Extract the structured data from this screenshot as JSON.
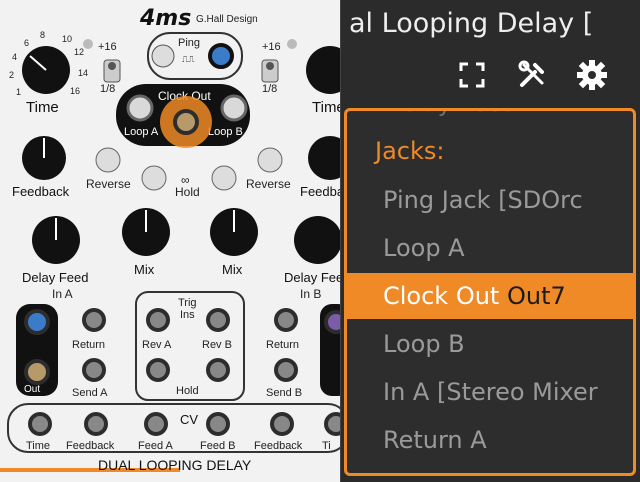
{
  "module": {
    "brand": "4ms",
    "maker": "G.Hall Design",
    "name": "DUAL LOOPING DELAY",
    "ping_label": "Ping",
    "ping_sub": "⎍⎍",
    "clock_out_label": "Clock Out",
    "loop_a_label": "Loop A",
    "loop_b_label": "Loop B",
    "time_label": "Time",
    "range_top": "+16",
    "range_bottom": "1/8",
    "feedback_label": "Feedback",
    "reverse_label": "Reverse",
    "hold_label": "Hold",
    "hold_symbol": "∞",
    "delay_feed_label": "Delay Feed",
    "mix_label": "Mix",
    "in_a_label": "In A",
    "in_b_label": "In B",
    "out_label": "Out",
    "return_label": "Return",
    "send_a_label": "Send A",
    "send_b_label": "Send B",
    "trig_ins_label": "Trig\nIns",
    "trig_label": "Trig",
    "ins_label": "Ins",
    "rev_a_label": "Rev A",
    "rev_b_label": "Rev B",
    "cv_label": "CV",
    "cv_jacks": [
      "Time",
      "Feedback",
      "Feed A",
      "Feed B",
      "Feedback",
      "Ti"
    ],
    "dial_numbers": [
      "1",
      "2",
      "4",
      "6",
      "8",
      "10",
      "12",
      "14",
      "16"
    ]
  },
  "panel": {
    "title": "al Looping Delay  [",
    "icons": [
      "fullscreen-icon",
      "tools-icon",
      "gear-icon"
    ],
    "scroll_hint": "Delay Feed B",
    "section_heading": "Jacks:",
    "items": [
      {
        "label": "Ping Jack [SDOrc",
        "badge": ""
      },
      {
        "label": "Loop A",
        "badge": ""
      },
      {
        "label": "Clock Out",
        "badge": "Out7"
      },
      {
        "label": "Loop B",
        "badge": ""
      },
      {
        "label": "In A [Stereo Mixer",
        "badge": ""
      },
      {
        "label": "Return A",
        "badge": ""
      }
    ],
    "selected_index": 2,
    "accent": "#ef8a26"
  }
}
